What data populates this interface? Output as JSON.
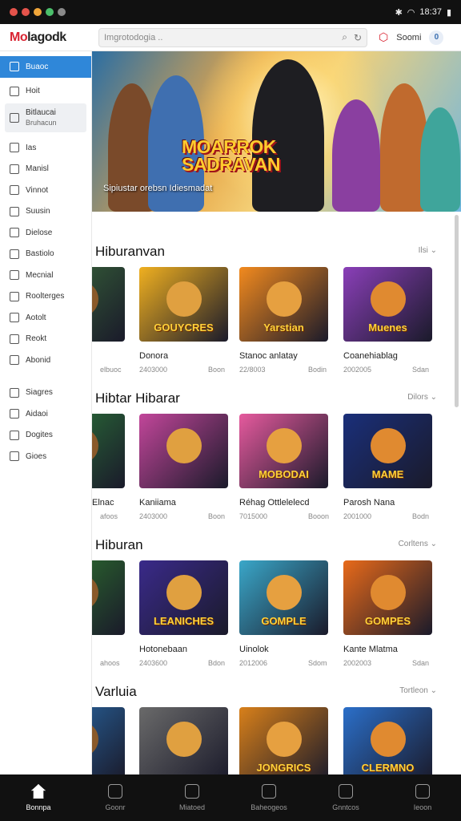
{
  "status": {
    "time": "18:37"
  },
  "header": {
    "logo_prefix": "Mo",
    "logo_rest": "lagodk",
    "search_placeholder": "Imgrotodogia ..",
    "account_label": "Soomi",
    "badge": "0"
  },
  "sidebar": {
    "items": [
      {
        "label": "Buaoc",
        "active": true
      },
      {
        "label": "Hoit"
      },
      {
        "label": "Bitlaucai",
        "sub": "Bruhacun",
        "boxed": true
      },
      {
        "label": "Ias"
      },
      {
        "label": "Manisl"
      },
      {
        "label": "Vinnot"
      },
      {
        "label": "Suusin"
      },
      {
        "label": "Dielose"
      },
      {
        "label": "Bastiolo"
      },
      {
        "label": "Mecnial"
      },
      {
        "label": "Roolterges"
      },
      {
        "label": "Aotolt"
      },
      {
        "label": "Reokt"
      },
      {
        "label": "Abonid"
      },
      {
        "label": "Siagres",
        "gap": true
      },
      {
        "label": "Aidaoi"
      },
      {
        "label": "Dogites"
      },
      {
        "label": "Gioes"
      }
    ]
  },
  "hero": {
    "title_line1": "MOARROK",
    "title_line2": "SADRAVAN",
    "subtitle": "Sipiustar orebsn Idiesmadat"
  },
  "sections": [
    {
      "title": "Hiburanvan",
      "more": "Ilsi",
      "tiles": [
        {
          "name": "",
          "meta": "elbuoc",
          "meta2": "",
          "art": ""
        },
        {
          "name": "Donora",
          "meta": "2403000",
          "meta2": "Boon",
          "art": "GOUYCRES"
        },
        {
          "name": "Stanoc anlatay",
          "meta": "22/8003",
          "meta2": "Bodin",
          "art": "Yarstian"
        },
        {
          "name": "Coanehiablag",
          "meta": "2002005",
          "meta2": "Sdan",
          "art": "Muenes"
        }
      ]
    },
    {
      "title": "Hibtar Hibarar",
      "more": "Dilors",
      "tiles": [
        {
          "name": "Elnac",
          "meta": "afoos",
          "meta2": "",
          "art": ""
        },
        {
          "name": "Kaniiama",
          "meta": "2403000",
          "meta2": "Boon",
          "art": ""
        },
        {
          "name": "Réhag Ottlelelecd",
          "meta": "7015000",
          "meta2": "Booon",
          "art": "MOBODAI"
        },
        {
          "name": "Parosh Nana",
          "meta": "2001000",
          "meta2": "Bodn",
          "art": "MAME"
        }
      ]
    },
    {
      "title": "Hiburan",
      "more": "Corltens",
      "tiles": [
        {
          "name": "",
          "meta": "ahoos",
          "meta2": "",
          "art": ""
        },
        {
          "name": "Hotonebaan",
          "meta": "2403600",
          "meta2": "Bdon",
          "art": "LEANICHES"
        },
        {
          "name": "Uinolok",
          "meta": "2012006",
          "meta2": "Sdom",
          "art": "GOMPLE"
        },
        {
          "name": "Kante Mlatma",
          "meta": "2002003",
          "meta2": "Sdan",
          "art": "GOMPES"
        }
      ]
    },
    {
      "title": "Varluia",
      "more": "Tortleon",
      "tiles": [
        {
          "name": "",
          "meta": "",
          "meta2": "",
          "art": ""
        },
        {
          "name": "",
          "meta": "",
          "meta2": "",
          "art": ""
        },
        {
          "name": "",
          "meta": "",
          "meta2": "",
          "art": "JONGRICS"
        },
        {
          "name": "",
          "meta": "",
          "meta2": "",
          "art": "CLERMNO"
        }
      ]
    }
  ],
  "bottom_nav": [
    {
      "label": "Bonnpa",
      "active": true
    },
    {
      "label": "Goonr"
    },
    {
      "label": "Miatoed"
    },
    {
      "label": "Baheogeos"
    },
    {
      "label": "Gnntcos"
    },
    {
      "label": "Ieoon"
    }
  ]
}
